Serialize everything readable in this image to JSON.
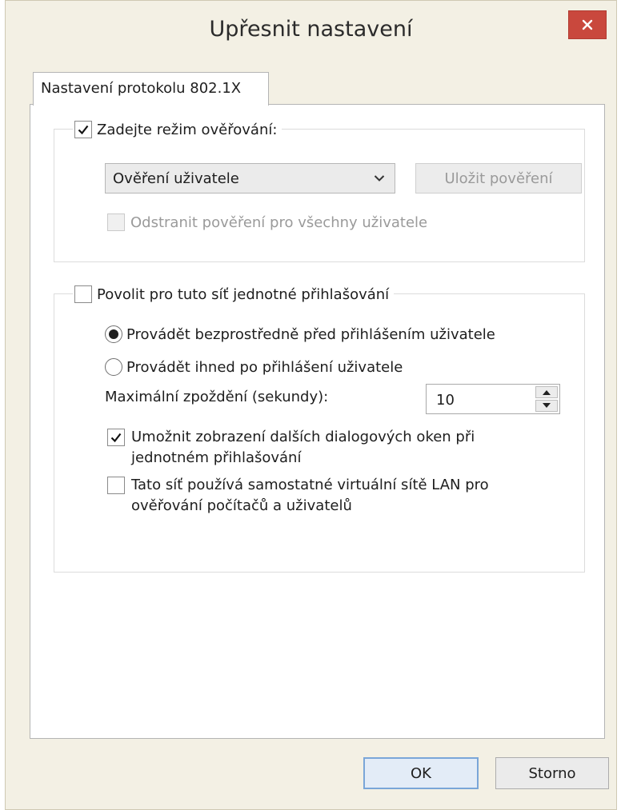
{
  "window": {
    "title": "Upřesnit nastavení"
  },
  "tab": {
    "label": "Nastavení protokolu 802.1X"
  },
  "auth_group": {
    "checkbox_label": "Zadejte režim ověřování:",
    "checked": true,
    "select_value": "Ověření uživatele",
    "save_button_label": "Uložit pověření",
    "remove_checkbox_label": "Odstranit pověření pro všechny uživatele",
    "remove_checked": false
  },
  "sso_group": {
    "checkbox_label": "Povolit pro tuto síť jednotné přihlašování",
    "checked": false,
    "radio_before_label": "Provádět bezprostředně před přihlášením uživatele",
    "radio_after_label": "Provádět ihned po přihlášení uživatele",
    "selected_radio": "before",
    "delay_label": "Maximální zpoždění (sekundy):",
    "delay_value": "10",
    "dialogs_line1": "Umožnit zobrazení dalších dialogových oken při",
    "dialogs_line2": "jednotném přihlašování",
    "dialogs_checked": true,
    "vlan_line1": "Tato síť používá samostatné virtuální sítě LAN pro",
    "vlan_line2": "ověřování počítačů a uživatelů",
    "vlan_checked": false
  },
  "buttons": {
    "ok": "OK",
    "cancel": "Storno"
  },
  "colors": {
    "close_button": "#c9483d",
    "window_frame": "#f3f0e4",
    "ok_border": "#7aa6d8"
  }
}
